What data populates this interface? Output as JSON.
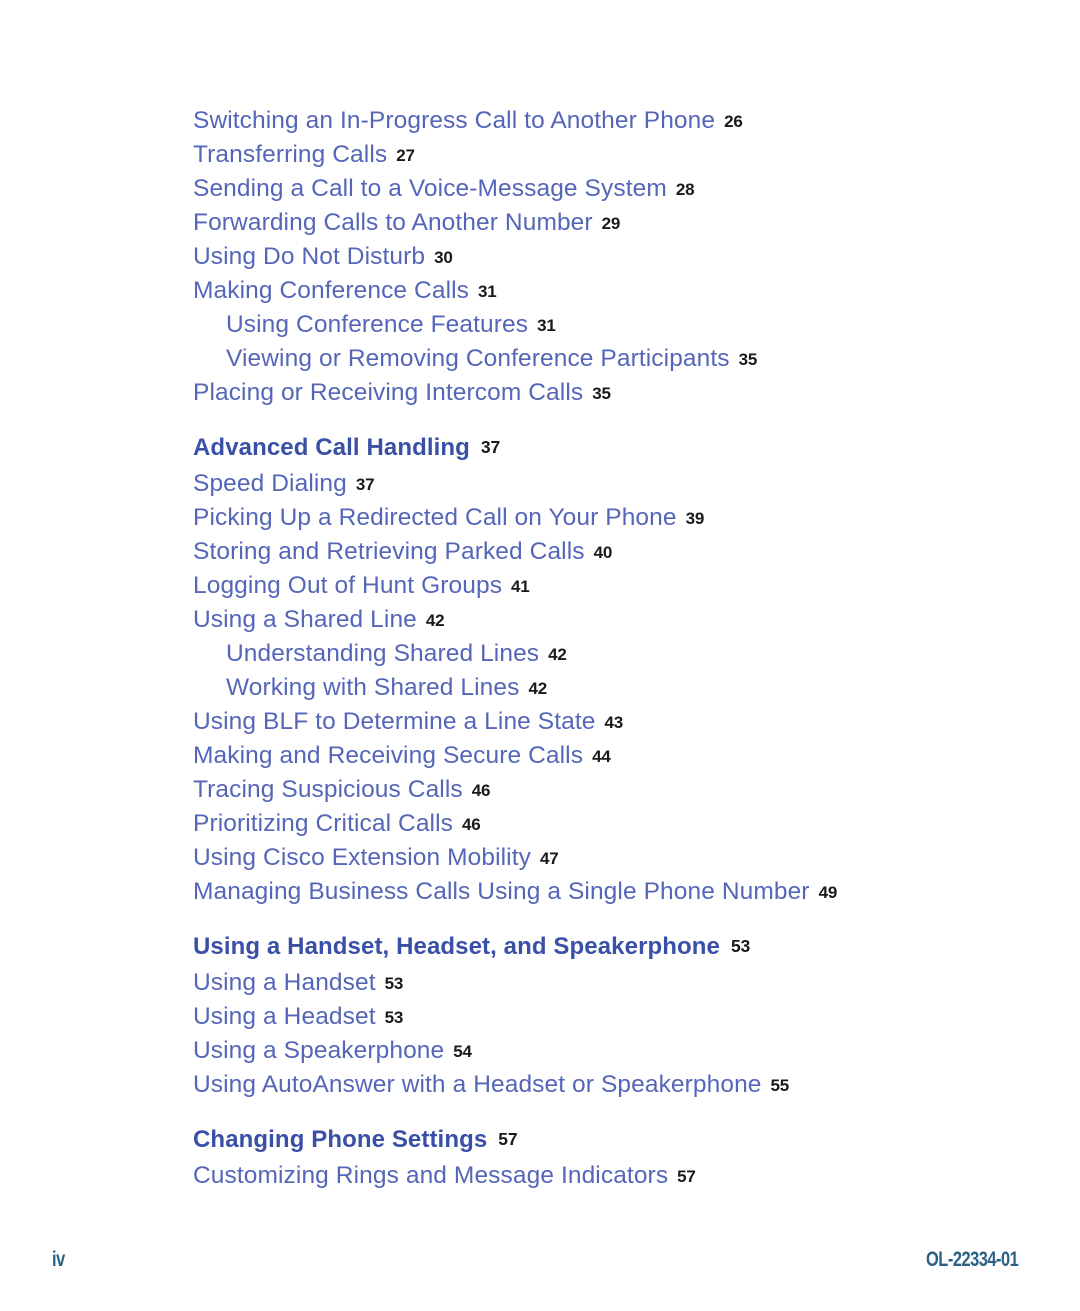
{
  "document": {
    "type": "table-of-contents",
    "colors": {
      "entry_text": "#5566b8",
      "heading_text": "#3a4fa6",
      "page_number": "#1a1a1a",
      "footer_text": "#2a6184",
      "background": "#ffffff"
    }
  },
  "toc": {
    "entries": [
      {
        "label": "Switching an In-Progress Call to Another Phone",
        "page": "26",
        "level": 1,
        "kind": "entry"
      },
      {
        "label": "Transferring Calls",
        "page": "27",
        "level": 1,
        "kind": "entry"
      },
      {
        "label": "Sending a Call to a Voice-Message System",
        "page": "28",
        "level": 1,
        "kind": "entry"
      },
      {
        "label": "Forwarding Calls to Another Number",
        "page": "29",
        "level": 1,
        "kind": "entry"
      },
      {
        "label": "Using Do Not Disturb",
        "page": "30",
        "level": 1,
        "kind": "entry"
      },
      {
        "label": "Making Conference Calls",
        "page": "31",
        "level": 1,
        "kind": "entry"
      },
      {
        "label": "Using Conference Features",
        "page": "31",
        "level": 2,
        "kind": "entry"
      },
      {
        "label": "Viewing or Removing Conference Participants",
        "page": "35",
        "level": 2,
        "kind": "entry"
      },
      {
        "label": "Placing or Receiving Intercom Calls",
        "page": "35",
        "level": 1,
        "kind": "entry"
      },
      {
        "label": "Advanced Call Handling",
        "page": "37",
        "level": 1,
        "kind": "heading"
      },
      {
        "label": "Speed Dialing",
        "page": "37",
        "level": 1,
        "kind": "entry"
      },
      {
        "label": "Picking Up a Redirected Call on Your Phone",
        "page": "39",
        "level": 1,
        "kind": "entry"
      },
      {
        "label": "Storing and Retrieving Parked Calls",
        "page": "40",
        "level": 1,
        "kind": "entry"
      },
      {
        "label": "Logging Out of Hunt Groups",
        "page": "41",
        "level": 1,
        "kind": "entry"
      },
      {
        "label": "Using a Shared Line",
        "page": "42",
        "level": 1,
        "kind": "entry"
      },
      {
        "label": "Understanding Shared Lines",
        "page": "42",
        "level": 2,
        "kind": "entry"
      },
      {
        "label": "Working with Shared Lines",
        "page": "42",
        "level": 2,
        "kind": "entry"
      },
      {
        "label": "Using BLF to Determine a Line State",
        "page": "43",
        "level": 1,
        "kind": "entry"
      },
      {
        "label": "Making and Receiving Secure Calls",
        "page": "44",
        "level": 1,
        "kind": "entry"
      },
      {
        "label": "Tracing Suspicious Calls",
        "page": "46",
        "level": 1,
        "kind": "entry"
      },
      {
        "label": "Prioritizing Critical Calls",
        "page": "46",
        "level": 1,
        "kind": "entry"
      },
      {
        "label": "Using Cisco Extension Mobility",
        "page": "47",
        "level": 1,
        "kind": "entry"
      },
      {
        "label": "Managing Business Calls Using a Single Phone Number",
        "page": "49",
        "level": 1,
        "kind": "entry"
      },
      {
        "label": "Using a Handset, Headset, and Speakerphone",
        "page": "53",
        "level": 1,
        "kind": "heading"
      },
      {
        "label": "Using a Handset",
        "page": "53",
        "level": 1,
        "kind": "entry"
      },
      {
        "label": "Using a Headset",
        "page": "53",
        "level": 1,
        "kind": "entry"
      },
      {
        "label": "Using a Speakerphone",
        "page": "54",
        "level": 1,
        "kind": "entry"
      },
      {
        "label": "Using AutoAnswer with a Headset or Speakerphone",
        "page": "55",
        "level": 1,
        "kind": "entry"
      },
      {
        "label": "Changing Phone Settings",
        "page": "57",
        "level": 1,
        "kind": "heading"
      },
      {
        "label": "Customizing Rings and Message Indicators",
        "page": "57",
        "level": 1,
        "kind": "entry"
      }
    ]
  },
  "footer": {
    "page_number": "iv",
    "document_id": "OL-22334-01"
  }
}
